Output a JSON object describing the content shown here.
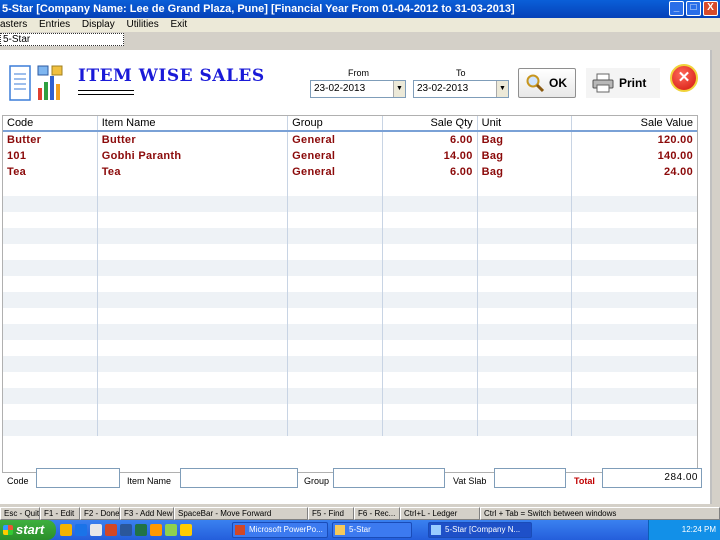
{
  "window": {
    "title": "5-Star [Company Name: Lee de Grand Plaza, Pune] [Financial Year From 01-04-2012 to 31-03-2013]",
    "buttons": [
      "_",
      "□",
      "X"
    ]
  },
  "menu": [
    "asters",
    "Entries",
    "Display",
    "Utilities",
    "Exit"
  ],
  "mdi_tab": "5-Star",
  "report": {
    "title": "ITEM WISE SALES",
    "from_label": "From",
    "to_label": "To",
    "from_date": "23-02-2013",
    "to_date": "23-02-2013",
    "ok_label": "OK",
    "print_label": "Print",
    "close_glyph": "✕"
  },
  "grid": {
    "columns": [
      "Code",
      "Item Name",
      "Group",
      "Sale Qty",
      "Unit",
      "Sale Value"
    ],
    "rows": [
      [
        "Butter",
        "Butter",
        "General",
        "6.00",
        "Bag",
        "120.00"
      ],
      [
        "101",
        "Gobhi Paranth",
        "General",
        "14.00",
        "Bag",
        "140.00"
      ],
      [
        "Tea",
        "Tea",
        "General",
        "6.00",
        "Bag",
        "24.00"
      ]
    ]
  },
  "filters": {
    "code_label": "Code",
    "item_label": "Item Name",
    "group_label": "Group",
    "vat_label": "Vat Slab",
    "total_label": "Total",
    "total_value": "284.00"
  },
  "shortcuts": [
    "Esc - Quit",
    "F1 - Edit",
    "F2 - Done",
    "F3 - Add New",
    "SpaceBar - Move Forward",
    "F5 - Find",
    "F6 - Rec...",
    "Ctrl+L - Ledger",
    "Ctrl + Tab = Switch between windows"
  ],
  "taskbar": {
    "start_label": "start",
    "tasks": [
      "Microsoft PowerPo...",
      "5-Star",
      "5-Star [Company N..."
    ],
    "clock": "12:24 PM"
  },
  "colors": {
    "title_blue": "#1a1ad8",
    "data_red": "#8b0a0a",
    "taskbar_blue": "#245edb"
  }
}
